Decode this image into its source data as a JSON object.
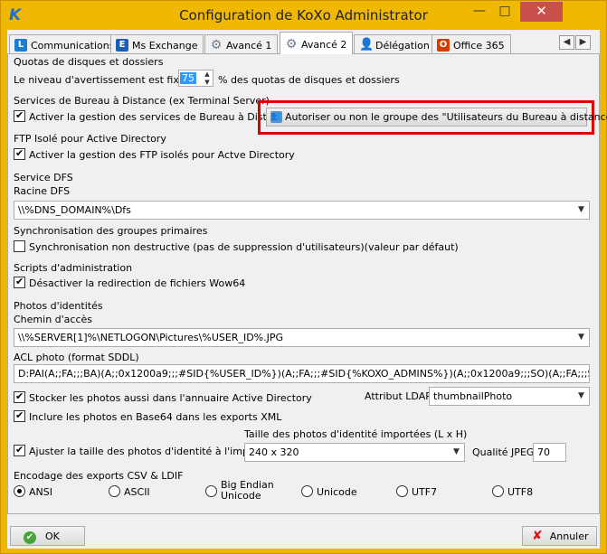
{
  "window": {
    "title": "Configuration de KoXo Administrator",
    "logo": "K",
    "minimize_icon": "minimize-icon",
    "maximize_icon": "maximize-icon",
    "close_icon": "close-icon"
  },
  "tabs": [
    {
      "label": "Communications",
      "icon": "communications-icon",
      "icon_glyph": "L"
    },
    {
      "label": "Ms Exchange",
      "icon": "exchange-icon",
      "icon_glyph": "E"
    },
    {
      "label": "Avancé 1",
      "icon": "gear-icon",
      "icon_glyph": "⚙"
    },
    {
      "label": "Avancé 2",
      "icon": "gear-icon",
      "icon_glyph": "⚙",
      "active": true
    },
    {
      "label": "Délégation",
      "icon": "person-icon",
      "icon_glyph": "👤"
    },
    {
      "label": "Office 365",
      "icon": "office365-icon",
      "icon_glyph": "O"
    }
  ],
  "tab_scroll": {
    "left": "◀",
    "right": "▶"
  },
  "quotas": {
    "header": "Quotas de disques et dossiers",
    "prefix": "Le niveau d'avertissement est fixé à",
    "value": "75",
    "suffix": "% des quotas de disques et dossiers"
  },
  "rds": {
    "header": "Services de Bureau à Distance (ex Terminal Server)",
    "enable_label": "Activer la gestion des services de Bureau à Distance",
    "enable_checked": true,
    "button_label": "Autoriser ou non le groupe des \"Utilisateurs du Bureau à distance\""
  },
  "ftp": {
    "header": "FTP Isolé pour Active Directory",
    "enable_label": "Activer la gestion des FTP isolés pour Actve Directory",
    "enable_checked": true
  },
  "dfs": {
    "header": "Service DFS",
    "root_label": "Racine DFS",
    "root_value": "\\\\%DNS_DOMAIN%\\Dfs"
  },
  "sync": {
    "header": "Synchronisation des groupes primaires",
    "label": "Synchronisation non destructive (pas de suppression d'utilisateurs)(valeur par défaut)",
    "checked": false
  },
  "scripts": {
    "header": "Scripts d'administration",
    "label": "Désactiver la redirection de fichiers Wow64",
    "checked": true
  },
  "photos": {
    "header": "Photos d'identités",
    "path_label": "Chemin d'accès",
    "path_value": "\\\\%SERVER[1]%\\NETLOGON\\Pictures\\%USER_ID%.JPG",
    "acl_label": "ACL photo (format SDDL)",
    "acl_value": "D:PAI(A;;FA;;;BA)(A;;0x1200a9;;;#SID{%USER_ID%})(A;;FA;;;#SID{%KOXO_ADMINS%})(A;;0x1200a9;;;SO)(A;;FA;;;SY)",
    "store_label": "Stocker les photos aussi dans l'annuaire Active Directory",
    "store_checked": true,
    "ldap_label": "Attribut LDAP",
    "ldap_value": "thumbnailPhoto",
    "base64_label": "Inclure les photos en Base64 dans les exports XML",
    "base64_checked": true,
    "resize_label": "Ajuster la taille des photos d'identité à l'import",
    "resize_checked": true,
    "size_label": "Taille des photos d'identité importées (L x H)",
    "size_value": "240 x 320",
    "quality_label": "Qualité JPEG",
    "quality_value": "70"
  },
  "encoding": {
    "header": "Encodage des exports CSV & LDIF",
    "options": [
      {
        "label": "ANSI",
        "checked": true
      },
      {
        "label": "ASCII",
        "checked": false
      },
      {
        "label": "Big Endian\nUnicode",
        "checked": false
      },
      {
        "label": "Unicode",
        "checked": false
      },
      {
        "label": "UTF7",
        "checked": false
      },
      {
        "label": "UTF8",
        "checked": false
      }
    ]
  },
  "footer": {
    "ok_label": "OK",
    "cancel_label": "Annuler"
  },
  "colors": {
    "title_bar": "#f0b800",
    "highlight_border": "#e00000",
    "selection": "#3399ff"
  }
}
